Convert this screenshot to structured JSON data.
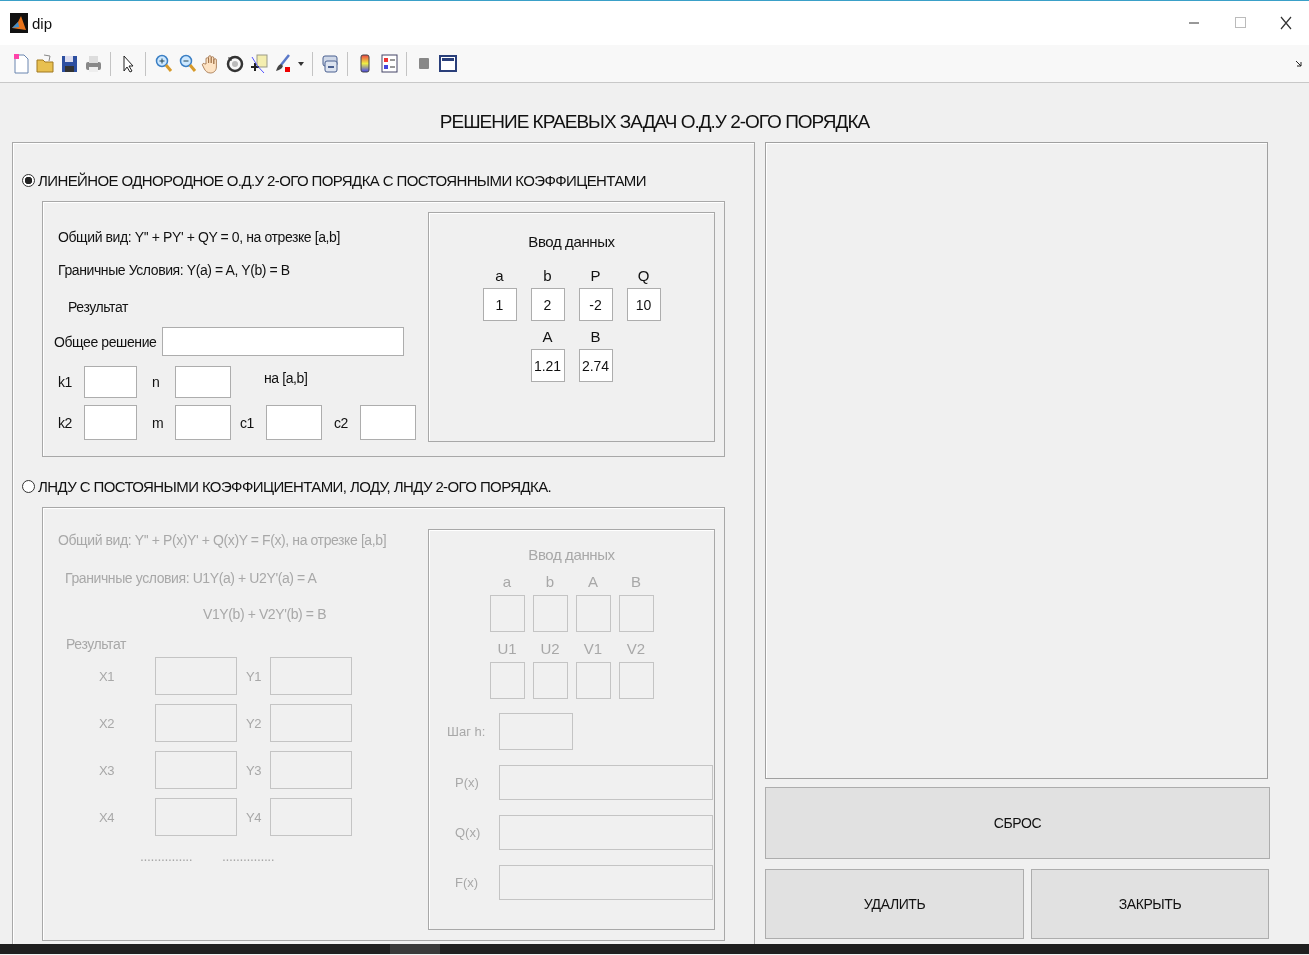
{
  "window": {
    "title": "dip"
  },
  "heading": "РЕШЕНИЕ КРАЕВЫХ ЗАДАЧ О.Д.У 2-ОГО ПОРЯДКА",
  "sections": [
    {
      "kind": "homogeneous",
      "label": "ЛИНЕЙНОЕ ОДНОРОДНОЕ О.Д.У 2-ОГО ПОРЯДКА С ПОСТОЯННЫМИ КОЭФФИЦЕНТАМИ",
      "selected": true,
      "disabled": false,
      "lines": [
        "Общий вид: Y'' + PY' + QY = 0, на отрезке [a,b]",
        "Граничные Условия: Y(a) = A, Y(b) = B"
      ],
      "result_label": "Результат",
      "general_solution": {
        "label": "Общее решение"
      },
      "field_rows": [
        [
          {
            "label": "k1"
          },
          {
            "label": "n"
          }
        ],
        [
          {
            "label": "k2"
          },
          {
            "label": "m"
          },
          {
            "label": "c1"
          },
          {
            "label": "c2"
          }
        ]
      ],
      "interval_note": "на [a,b]",
      "input": {
        "title": "Ввод данных",
        "rows": [
          [
            {
              "label": "a",
              "value": "1"
            },
            {
              "label": "b",
              "value": "2"
            },
            {
              "label": "P",
              "value": "-2"
            },
            {
              "label": "Q",
              "value": "10"
            }
          ],
          [
            "",
            {
              "label": "A",
              "value": "1.21"
            },
            {
              "label": "B",
              "value": "2.74"
            }
          ]
        ]
      }
    },
    {
      "kind": "nonhomogeneous",
      "label": "ЛНДУ С ПОСТОЯНЫМИ КОЭФФИЦИЕНТАМИ, ЛОДУ, ЛНДУ 2-ОГО ПОРЯДКА.",
      "selected": false,
      "disabled": true,
      "lines": [
        "Общий вид: Y'' + P(x)Y' + Q(x)Y = F(x), на отрезке [a,b]",
        "Граничные условия: U1Y(a) + U2Y'(a) = A",
        "V1Y(b) + V2Y'(b) = B"
      ],
      "result_label": "Результат",
      "result_rows": [
        {
          "x_label": "X1",
          "y_label": "Y1"
        },
        {
          "x_label": "X2",
          "y_label": "Y2"
        },
        {
          "x_label": "X3",
          "y_label": "Y3"
        },
        {
          "x_label": "X4",
          "y_label": "Y4"
        }
      ],
      "ellipses": [
        "...............",
        "..............."
      ],
      "input": {
        "title": "Ввод данных",
        "rows": [
          [
            {
              "label": "a"
            },
            {
              "label": "b"
            },
            {
              "label": "A"
            },
            {
              "label": "B"
            }
          ],
          [
            {
              "label": "U1"
            },
            {
              "label": "U2"
            },
            {
              "label": "V1"
            },
            {
              "label": "V2"
            }
          ]
        ],
        "step": {
          "label": "Шаг h:"
        },
        "functions": [
          {
            "label": "P(x)"
          },
          {
            "label": "Q(x)"
          },
          {
            "label": "F(x)"
          }
        ]
      }
    }
  ],
  "buttons": [
    {
      "label": "СБРОС"
    },
    {
      "label": "УДАЛИТЬ"
    },
    {
      "label": "ЗАКРЫТЬ"
    }
  ]
}
